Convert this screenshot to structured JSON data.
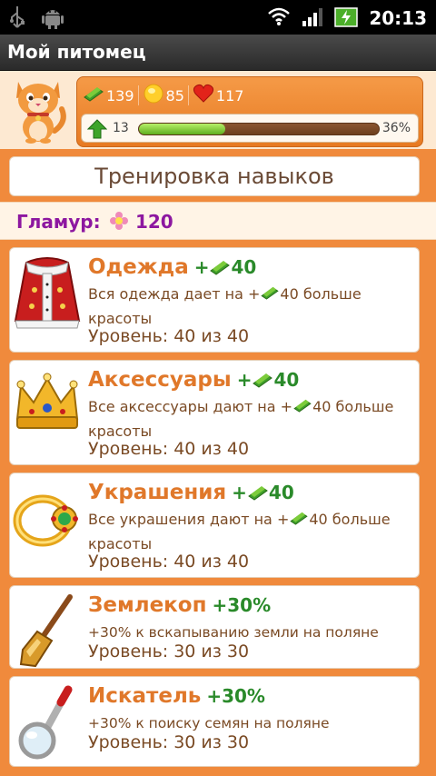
{
  "status_bar": {
    "time": "20:13"
  },
  "app": {
    "title": "Мой питомец"
  },
  "stats": {
    "money": "139",
    "coins": "85",
    "hearts": "117",
    "level": "13",
    "progress_percent": "36%",
    "progress_value": 0.36
  },
  "skills": {
    "title": "Тренировка навыков",
    "glamour_label": "Гламур:",
    "glamour_value": "120",
    "items": [
      {
        "name": "Одежда",
        "bonus": "40",
        "desc_prefix": "Вся одежда дает на +",
        "desc_value": "40",
        "desc_suffix": " больше красоты",
        "level": "Уровень: 40 из 40"
      },
      {
        "name": "Аксессуары",
        "bonus": "40",
        "desc_prefix": "Все аксессуары дают на +",
        "desc_value": "40",
        "desc_suffix": " больше красоты",
        "level": "Уровень: 40 из 40"
      },
      {
        "name": "Украшения",
        "bonus": "40",
        "desc_prefix": "Все украшения дают на +",
        "desc_value": "40",
        "desc_suffix": " больше красоты",
        "level": "Уровень: 40 из 40"
      },
      {
        "name": "Землекоп",
        "bonus": "+30%",
        "desc": "+30% к вскапыванию земли на поляне",
        "level": "Уровень: 30 из 30"
      },
      {
        "name": "Искатель",
        "bonus": "+30%",
        "desc": "+30% к поиску семян на поляне",
        "level": "Уровень: 30 из 30"
      }
    ]
  },
  "icons": {
    "usb": "usb-icon",
    "android": "android-icon",
    "wifi": "wifi-icon",
    "signal": "signal-icon",
    "battery": "battery-icon",
    "money": "money-icon",
    "coin": "coin-icon",
    "heart": "heart-icon",
    "level_up": "level-up-arrow-icon",
    "glamour": "glamour-flower-icon"
  },
  "colors": {
    "accent_orange": "#f08a3c",
    "skill_name": "#e0782a",
    "bonus_green": "#2a8a2a",
    "glamour_purple": "#8d17a0"
  }
}
